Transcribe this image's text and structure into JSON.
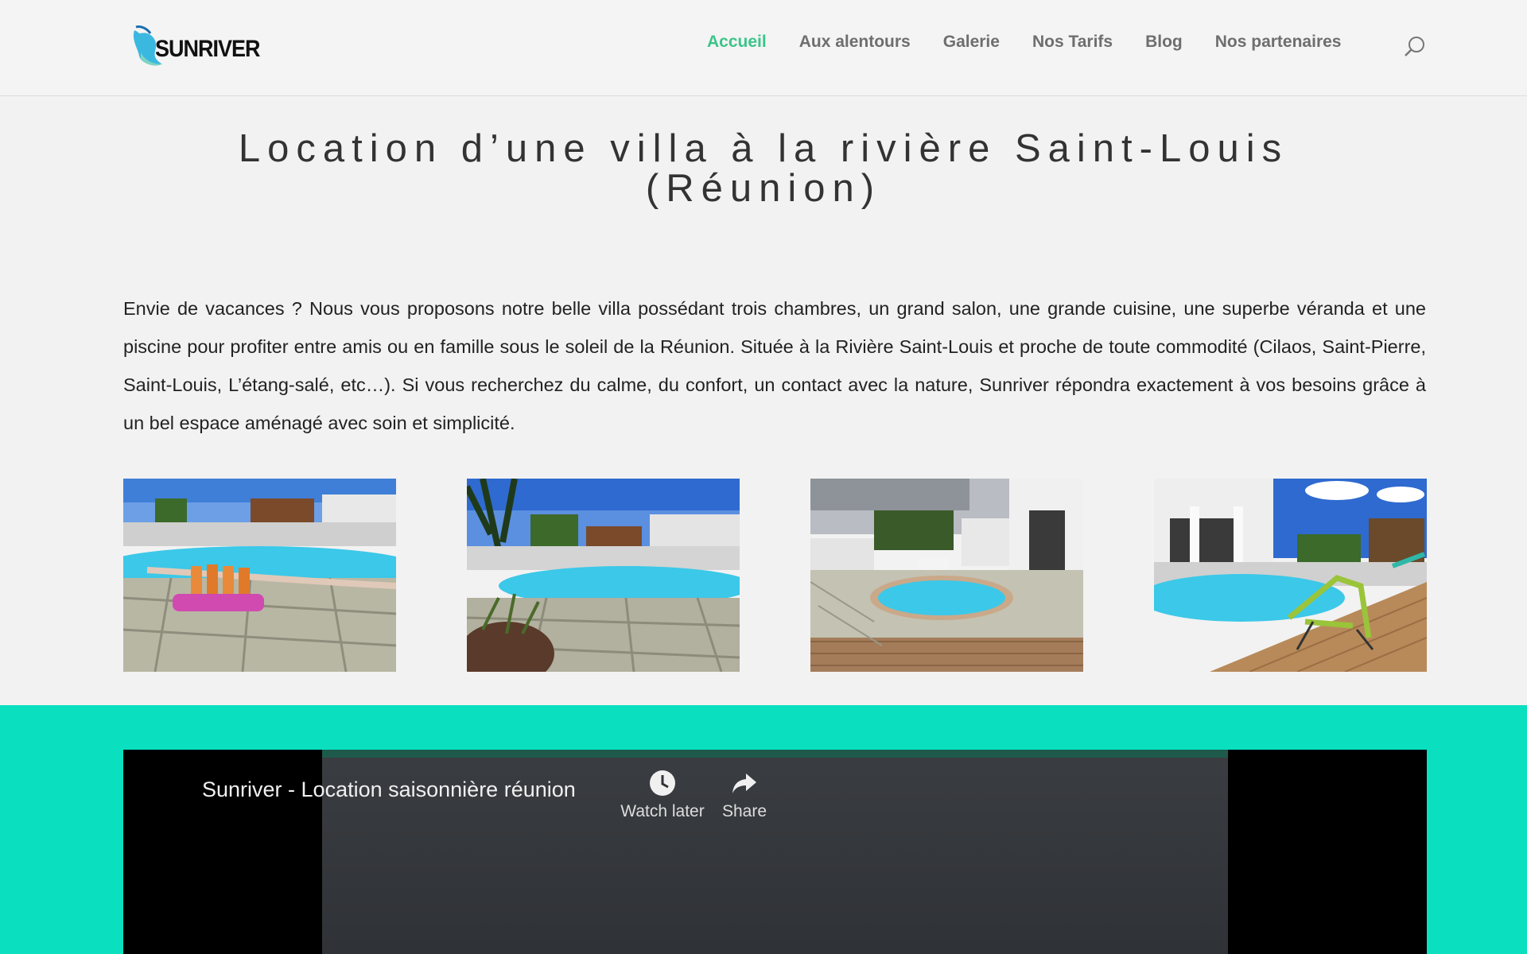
{
  "brand": {
    "name": "SUNRIVER"
  },
  "nav": {
    "items": [
      {
        "label": "Accueil",
        "active": true
      },
      {
        "label": "Aux alentours",
        "active": false
      },
      {
        "label": "Galerie",
        "active": false
      },
      {
        "label": "Nos Tarifs",
        "active": false
      },
      {
        "label": "Blog",
        "active": false
      },
      {
        "label": "Nos partenaires",
        "active": false
      }
    ],
    "search_icon": "search-icon"
  },
  "page": {
    "title_line1": "Location d’une villa à la rivière Saint-Louis",
    "title_line2": "(Réunion)",
    "intro": "Envie de vacances ? Nous vous proposons notre belle villa possédant trois chambres, un grand salon, une grande cuisine, une superbe véranda et une piscine pour profiter entre amis ou en famille sous le soleil de la Réunion. Située à la Rivière Saint-Louis et proche de toute commodité (Cilaos, Saint-Pierre, Saint-Louis, L’étang-salé, etc…). Si vous recherchez du calme, du confort, un contact avec la nature, Sunriver répondra exactement à vos besoins grâce à un bel espace aménagé avec soin et simplicité."
  },
  "video": {
    "title": "Sunriver - Location saisonnière réunion",
    "watch_later_label": "Watch later",
    "share_label": "Share"
  },
  "colors": {
    "accent": "#3cc48a",
    "teal_band": "#0ae0c0",
    "header_bg": "#f4f4f4",
    "page_bg": "#f2f2f2"
  }
}
